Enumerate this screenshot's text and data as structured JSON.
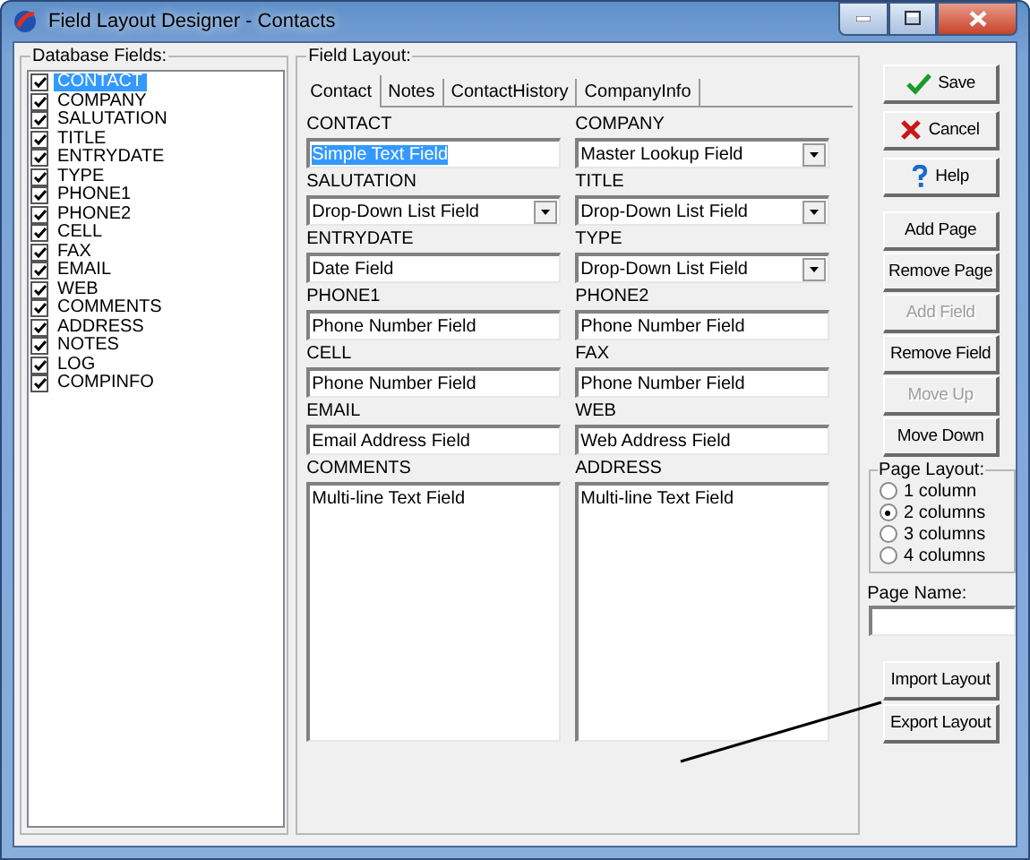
{
  "window": {
    "title": "Field Layout Designer - Contacts"
  },
  "database_fields": {
    "label": "Database Fields:",
    "items": [
      {
        "name": "CONTACT",
        "checked": true,
        "selected": true
      },
      {
        "name": "COMPANY",
        "checked": true,
        "selected": false
      },
      {
        "name": "SALUTATION",
        "checked": true,
        "selected": false
      },
      {
        "name": "TITLE",
        "checked": true,
        "selected": false
      },
      {
        "name": "ENTRYDATE",
        "checked": true,
        "selected": false
      },
      {
        "name": "TYPE",
        "checked": true,
        "selected": false
      },
      {
        "name": "PHONE1",
        "checked": true,
        "selected": false
      },
      {
        "name": "PHONE2",
        "checked": true,
        "selected": false
      },
      {
        "name": "CELL",
        "checked": true,
        "selected": false
      },
      {
        "name": "FAX",
        "checked": true,
        "selected": false
      },
      {
        "name": "EMAIL",
        "checked": true,
        "selected": false
      },
      {
        "name": "WEB",
        "checked": true,
        "selected": false
      },
      {
        "name": "COMMENTS",
        "checked": true,
        "selected": false
      },
      {
        "name": "ADDRESS",
        "checked": true,
        "selected": false
      },
      {
        "name": "NOTES",
        "checked": true,
        "selected": false
      },
      {
        "name": "LOG",
        "checked": true,
        "selected": false
      },
      {
        "name": "COMPINFO",
        "checked": true,
        "selected": false
      }
    ]
  },
  "field_layout": {
    "label": "Field Layout:",
    "tabs": [
      {
        "label": "Contact",
        "selected": true
      },
      {
        "label": "Notes",
        "selected": false
      },
      {
        "label": "ContactHistory",
        "selected": false
      },
      {
        "label": "CompanyInfo",
        "selected": false
      }
    ],
    "fields": [
      {
        "label": "CONTACT",
        "kind": "text",
        "value": "Simple Text Field",
        "selected": true
      },
      {
        "label": "COMPANY",
        "kind": "dropdown",
        "value": "Master Lookup Field",
        "selected": false
      },
      {
        "label": "SALUTATION",
        "kind": "dropdown",
        "value": "Drop-Down List Field",
        "selected": false
      },
      {
        "label": "TITLE",
        "kind": "dropdown",
        "value": "Drop-Down List Field",
        "selected": false
      },
      {
        "label": "ENTRYDATE",
        "kind": "text",
        "value": "Date Field",
        "selected": false
      },
      {
        "label": "TYPE",
        "kind": "dropdown",
        "value": "Drop-Down List Field",
        "selected": false
      },
      {
        "label": "PHONE1",
        "kind": "text",
        "value": "Phone Number Field",
        "selected": false
      },
      {
        "label": "PHONE2",
        "kind": "text",
        "value": "Phone Number Field",
        "selected": false
      },
      {
        "label": "CELL",
        "kind": "text",
        "value": "Phone Number Field",
        "selected": false
      },
      {
        "label": "FAX",
        "kind": "text",
        "value": "Phone Number Field",
        "selected": false
      },
      {
        "label": "EMAIL",
        "kind": "text",
        "value": "Email Address Field",
        "selected": false
      },
      {
        "label": "WEB",
        "kind": "text",
        "value": "Web Address Field",
        "selected": false
      },
      {
        "label": "COMMENTS",
        "kind": "memo",
        "value": "Multi-line Text Field",
        "selected": false
      },
      {
        "label": "ADDRESS",
        "kind": "memo",
        "value": "Multi-line Text Field",
        "selected": false
      }
    ]
  },
  "buttons": [
    {
      "label": "Save",
      "disabled": false
    },
    {
      "label": "Cancel",
      "disabled": false
    },
    {
      "label": "Help",
      "disabled": false
    },
    {
      "label": "Add Page",
      "disabled": false
    },
    {
      "label": "Remove Page",
      "disabled": false
    },
    {
      "label": "Add Field",
      "disabled": true
    },
    {
      "label": "Remove Field",
      "disabled": false
    },
    {
      "label": "Move Up",
      "disabled": true
    },
    {
      "label": "Move Down",
      "disabled": false
    }
  ],
  "page_layout": {
    "label": "Page Layout:",
    "options": [
      {
        "label": "1 column",
        "selected": false
      },
      {
        "label": "2 columns",
        "selected": true
      },
      {
        "label": "3 columns",
        "selected": false
      },
      {
        "label": "4 columns",
        "selected": false
      }
    ]
  },
  "page_name": {
    "label": "Page Name:"
  },
  "layout_buttons": [
    {
      "label": "Import Layout"
    },
    {
      "label": "Export Layout"
    }
  ]
}
